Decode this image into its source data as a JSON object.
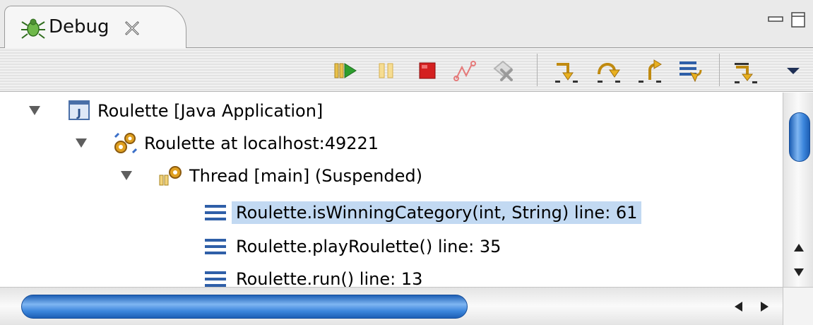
{
  "view": {
    "tab_title": "Debug",
    "tab_icon": "debug-bug-icon",
    "close_icon": "close-icon"
  },
  "toolbar": {
    "items": [
      {
        "name": "resume-button",
        "icon": "resume-icon",
        "color": "#2e9e2e"
      },
      {
        "name": "suspend-button",
        "icon": "suspend-icon",
        "color": "#e8c04a"
      },
      {
        "name": "terminate-button",
        "icon": "terminate-icon",
        "color": "#d42020"
      },
      {
        "name": "disconnect-button",
        "icon": "disconnect-icon"
      },
      {
        "name": "remove-terminated-button",
        "icon": "remove-terminated-icon"
      },
      {
        "name": "step-into-button",
        "icon": "step-into-icon"
      },
      {
        "name": "step-over-button",
        "icon": "step-over-icon"
      },
      {
        "name": "step-return-button",
        "icon": "step-return-icon"
      },
      {
        "name": "drop-to-frame-button",
        "icon": "drop-to-frame-icon"
      },
      {
        "name": "use-step-filters-button",
        "icon": "step-filters-icon"
      },
      {
        "name": "view-menu-button",
        "icon": "chevron-down-icon"
      }
    ]
  },
  "tree": {
    "rows": [
      {
        "label": "Roulette [Java Application]",
        "icon": "java-application-icon",
        "expanded": true
      },
      {
        "label": "Roulette at localhost:49221",
        "icon": "debug-target-icon",
        "expanded": true
      },
      {
        "label": "Thread [main] (Suspended)",
        "icon": "suspended-thread-icon",
        "expanded": true
      },
      {
        "label": "Roulette.isWinningCategory(int, String) line: 61",
        "icon": "stack-frame-icon",
        "selected": true
      },
      {
        "label": "Roulette.playRoulette() line: 35",
        "icon": "stack-frame-icon"
      },
      {
        "label": "Roulette.run() line: 13",
        "icon": "stack-frame-icon"
      }
    ]
  },
  "colors": {
    "selection": "#c2d9f2",
    "scroll_thumb": "#3c86dc"
  }
}
